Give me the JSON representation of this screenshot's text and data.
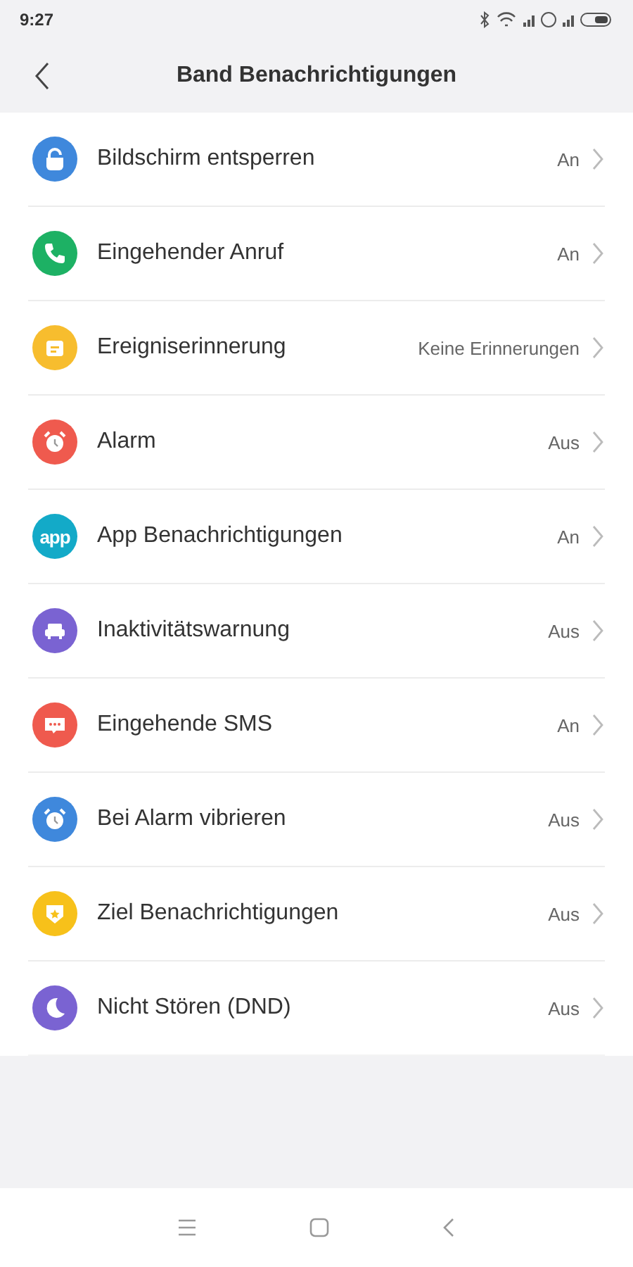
{
  "status_bar": {
    "time": "9:27"
  },
  "header": {
    "title": "Band Benachrichtigungen"
  },
  "items": [
    {
      "label": "Bildschirm entsperren",
      "value": "An",
      "kind": "unlock",
      "color": "#3f88dc"
    },
    {
      "label": "Eingehender Anruf",
      "value": "An",
      "kind": "phone",
      "color": "#1db164"
    },
    {
      "label": "Ereigniserinnerung",
      "value": "Keine Erinnerungen",
      "kind": "calendar",
      "color": "#f7bd2e"
    },
    {
      "label": "Alarm",
      "value": "Aus",
      "kind": "alarm",
      "color": "#ef5a4e"
    },
    {
      "label": "App Benachrichtigungen",
      "value": "An",
      "kind": "app",
      "color": "#13aac8",
      "badge": "app"
    },
    {
      "label": "Inaktivitätswarnung",
      "value": "Aus",
      "kind": "sofa",
      "color": "#7a63d2"
    },
    {
      "label": "Eingehende SMS",
      "value": "An",
      "kind": "sms",
      "color": "#ef5a4e"
    },
    {
      "label": "Bei Alarm vibrieren",
      "value": "Aus",
      "kind": "alarm",
      "color": "#3f88dc"
    },
    {
      "label": "Ziel Benachrichtigungen",
      "value": "Aus",
      "kind": "goal",
      "color": "#f7c11a"
    },
    {
      "label": "Nicht Stören (DND)",
      "value": "Aus",
      "kind": "moon",
      "color": "#7a63d2"
    }
  ]
}
